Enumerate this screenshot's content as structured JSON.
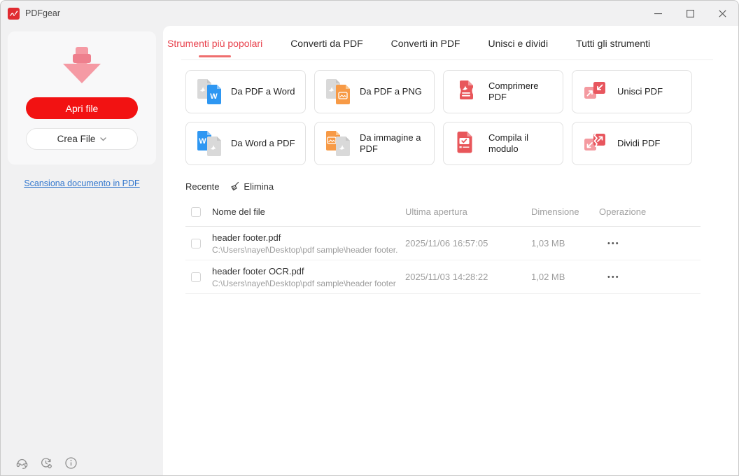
{
  "window": {
    "title": "PDFgear"
  },
  "titlebar": {
    "controls": [
      "minimize",
      "maximize",
      "close"
    ]
  },
  "sidebar": {
    "open_button": "Apri file",
    "create_button": "Crea File",
    "scan_link": "Scansiona documento in PDF",
    "footer_icons": [
      "support-icon",
      "update-history-icon",
      "info-icon"
    ]
  },
  "tabs": [
    {
      "label": "Strumenti più popolari",
      "active": true
    },
    {
      "label": "Converti da PDF",
      "active": false
    },
    {
      "label": "Converti in PDF",
      "active": false
    },
    {
      "label": "Unisci e dividi",
      "active": false
    },
    {
      "label": "Tutti gli strumenti",
      "active": false
    }
  ],
  "tools": [
    {
      "label": "Da PDF a Word",
      "icon": "pdf-to-word-icon"
    },
    {
      "label": "Da PDF a PNG",
      "icon": "pdf-to-png-icon"
    },
    {
      "label": "Comprimere PDF",
      "icon": "compress-pdf-icon"
    },
    {
      "label": "Unisci PDF",
      "icon": "merge-pdf-icon"
    },
    {
      "label": "Da Word a PDF",
      "icon": "word-to-pdf-icon"
    },
    {
      "label": "Da immagine a PDF",
      "icon": "image-to-pdf-icon"
    },
    {
      "label": "Compila il modulo",
      "icon": "fill-form-icon"
    },
    {
      "label": "Dividi PDF",
      "icon": "split-pdf-icon"
    }
  ],
  "recent": {
    "title": "Recente",
    "delete_label": "Elimina",
    "delete_icon": "broom-icon"
  },
  "table": {
    "headers": {
      "name": "Nome del file",
      "opened": "Ultima apertura",
      "size": "Dimensione",
      "operation": "Operazione"
    },
    "more_icon": "•••",
    "rows": [
      {
        "name": "header footer.pdf",
        "path": "C:\\Users\\nayel\\Desktop\\pdf sample\\header footer.",
        "opened": "2025/11/06 16:57:05",
        "size": "1,03 MB"
      },
      {
        "name": "header footer OCR.pdf",
        "path": "C:\\Users\\nayel\\Desktop\\pdf sample\\header footer",
        "opened": "2025/11/03 14:28:22",
        "size": "1,02 MB"
      }
    ]
  },
  "colors": {
    "brand_red": "#f21212",
    "tab_active_red": "#e8434e",
    "tab_underline": "#ef6e6e",
    "link_blue": "#3176cd",
    "word_blue": "#2e97f2",
    "image_orange": "#f79a46",
    "icon_red": "#e8565a",
    "icon_pink": "#f49aa0",
    "doc_gray": "#d9d9d9",
    "titlebar_bg": "#f1f1f2",
    "main_bg": "#ffffff"
  }
}
